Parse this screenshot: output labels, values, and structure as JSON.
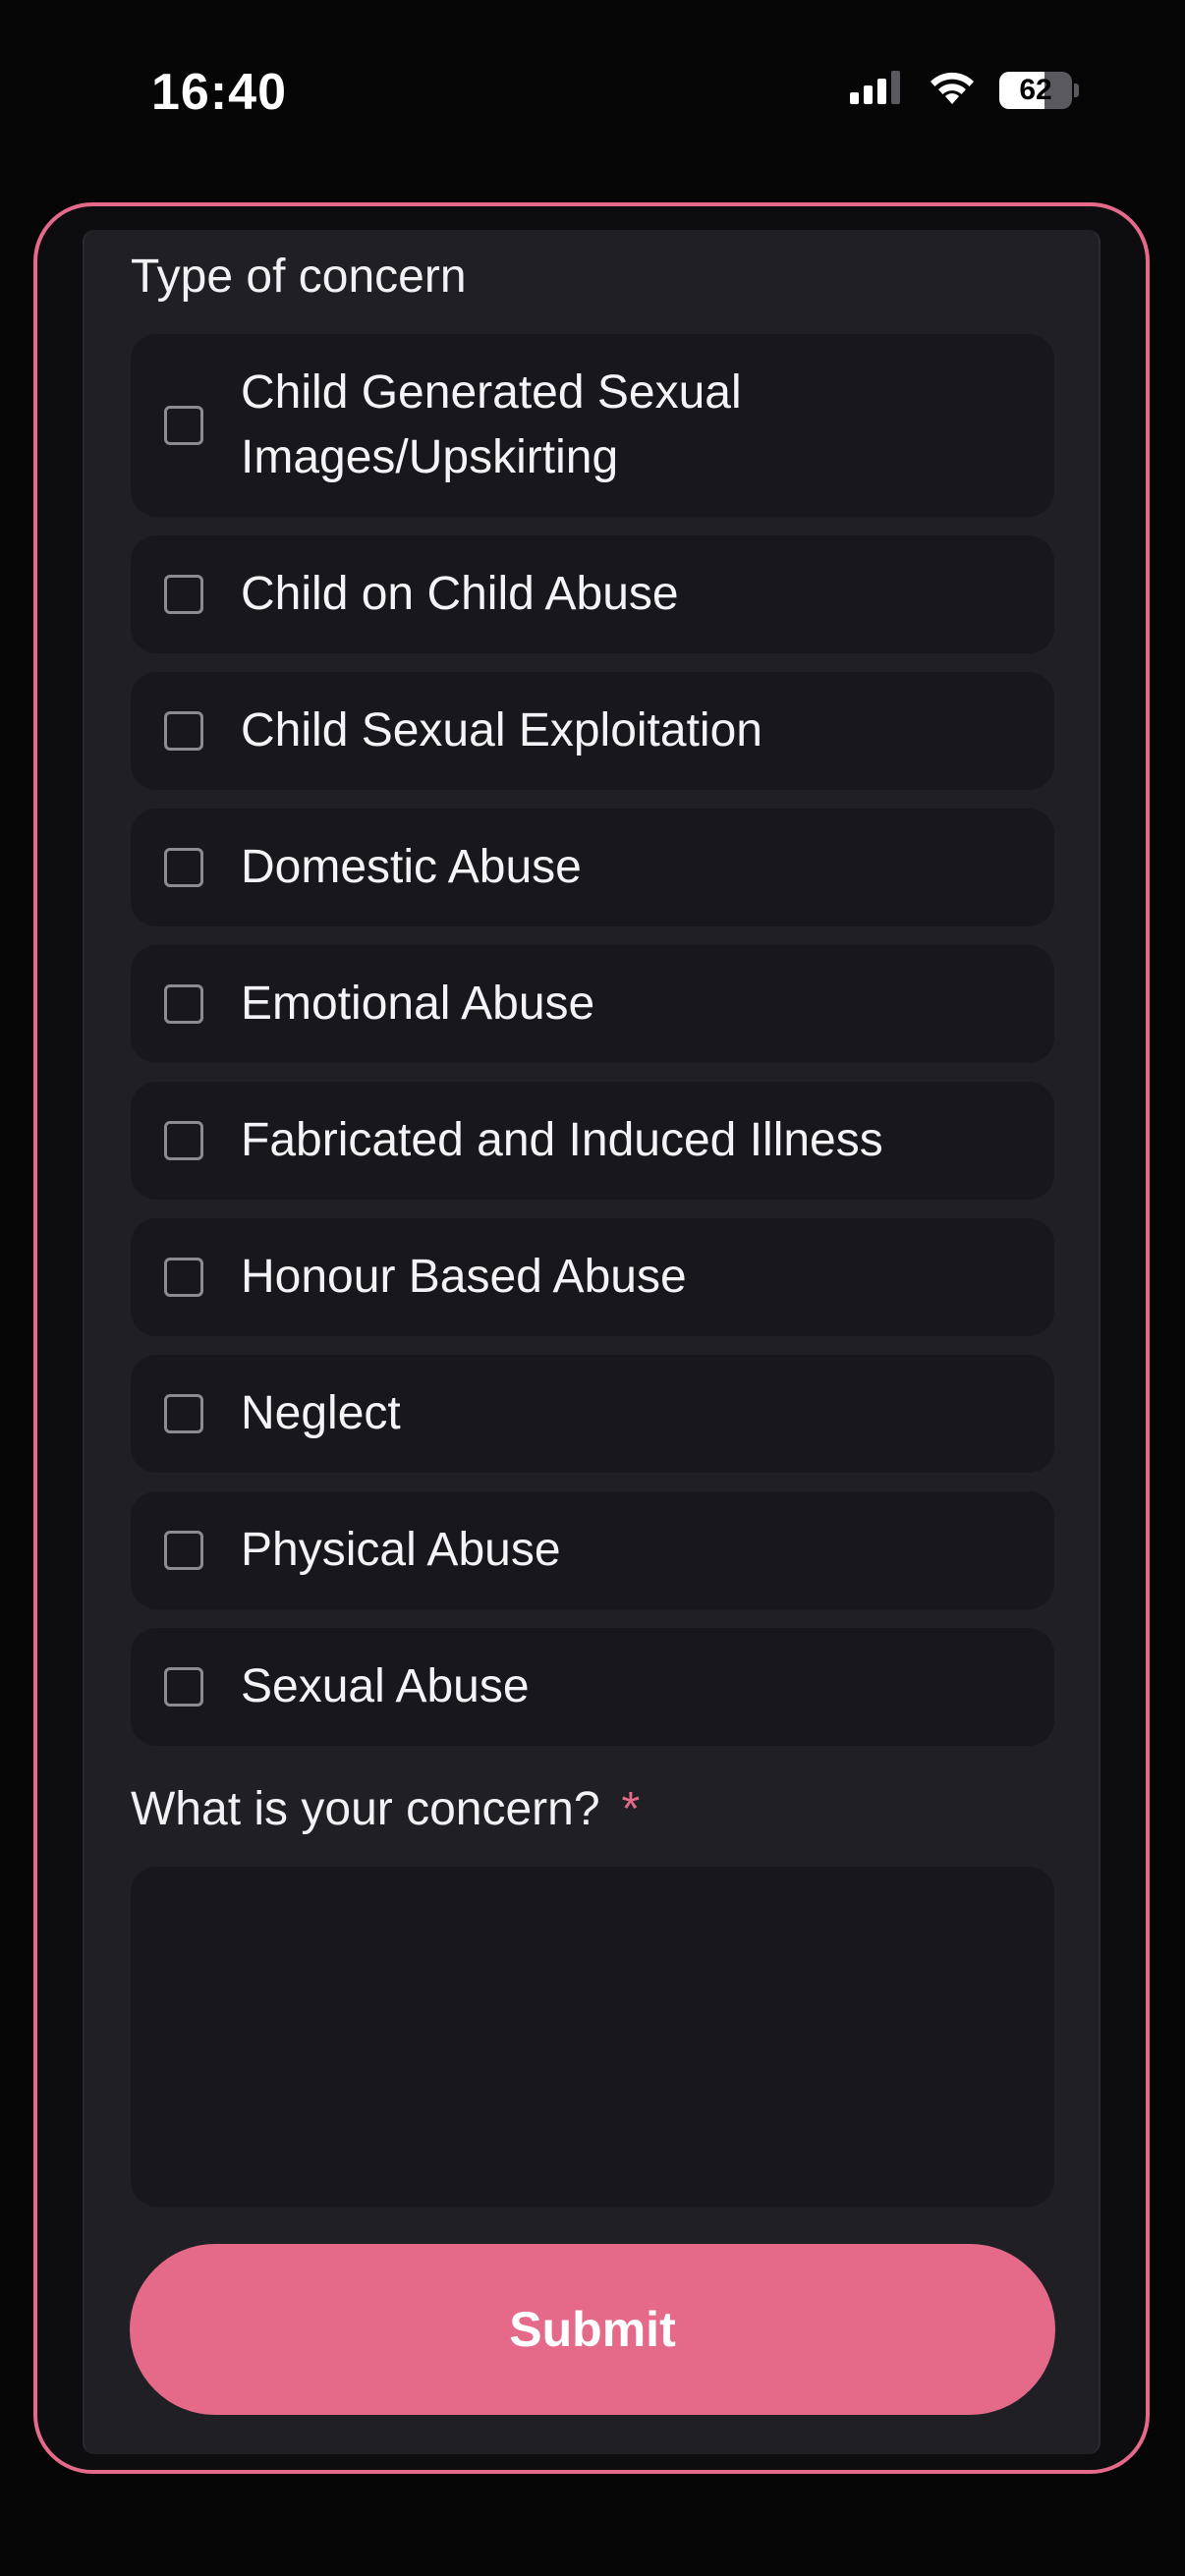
{
  "status_bar": {
    "time": "16:40",
    "battery_percent": "62",
    "battery_level": 0.62,
    "icons": [
      "cellular-signal-icon",
      "wifi-icon",
      "battery-icon"
    ]
  },
  "form": {
    "type_label": "Type of concern",
    "options": [
      {
        "label": "Child Generated Sexual Images/Upskirting",
        "checked": false
      },
      {
        "label": "Child on Child Abuse",
        "checked": false
      },
      {
        "label": "Child Sexual Exploitation",
        "checked": false
      },
      {
        "label": "Domestic Abuse",
        "checked": false
      },
      {
        "label": "Emotional Abuse",
        "checked": false
      },
      {
        "label": "Fabricated and Induced Illness",
        "checked": false
      },
      {
        "label": "Honour Based Abuse",
        "checked": false
      },
      {
        "label": "Neglect",
        "checked": false
      },
      {
        "label": "Physical Abuse",
        "checked": false
      },
      {
        "label": "Sexual Abuse",
        "checked": false
      }
    ],
    "concern_label": "What is your concern?",
    "required_marker": "*",
    "concern_value": "",
    "submit_label": "Submit"
  },
  "colors": {
    "accent": "#e56a8a",
    "background": "#060607",
    "card": "#202024",
    "field": "#18181c"
  }
}
